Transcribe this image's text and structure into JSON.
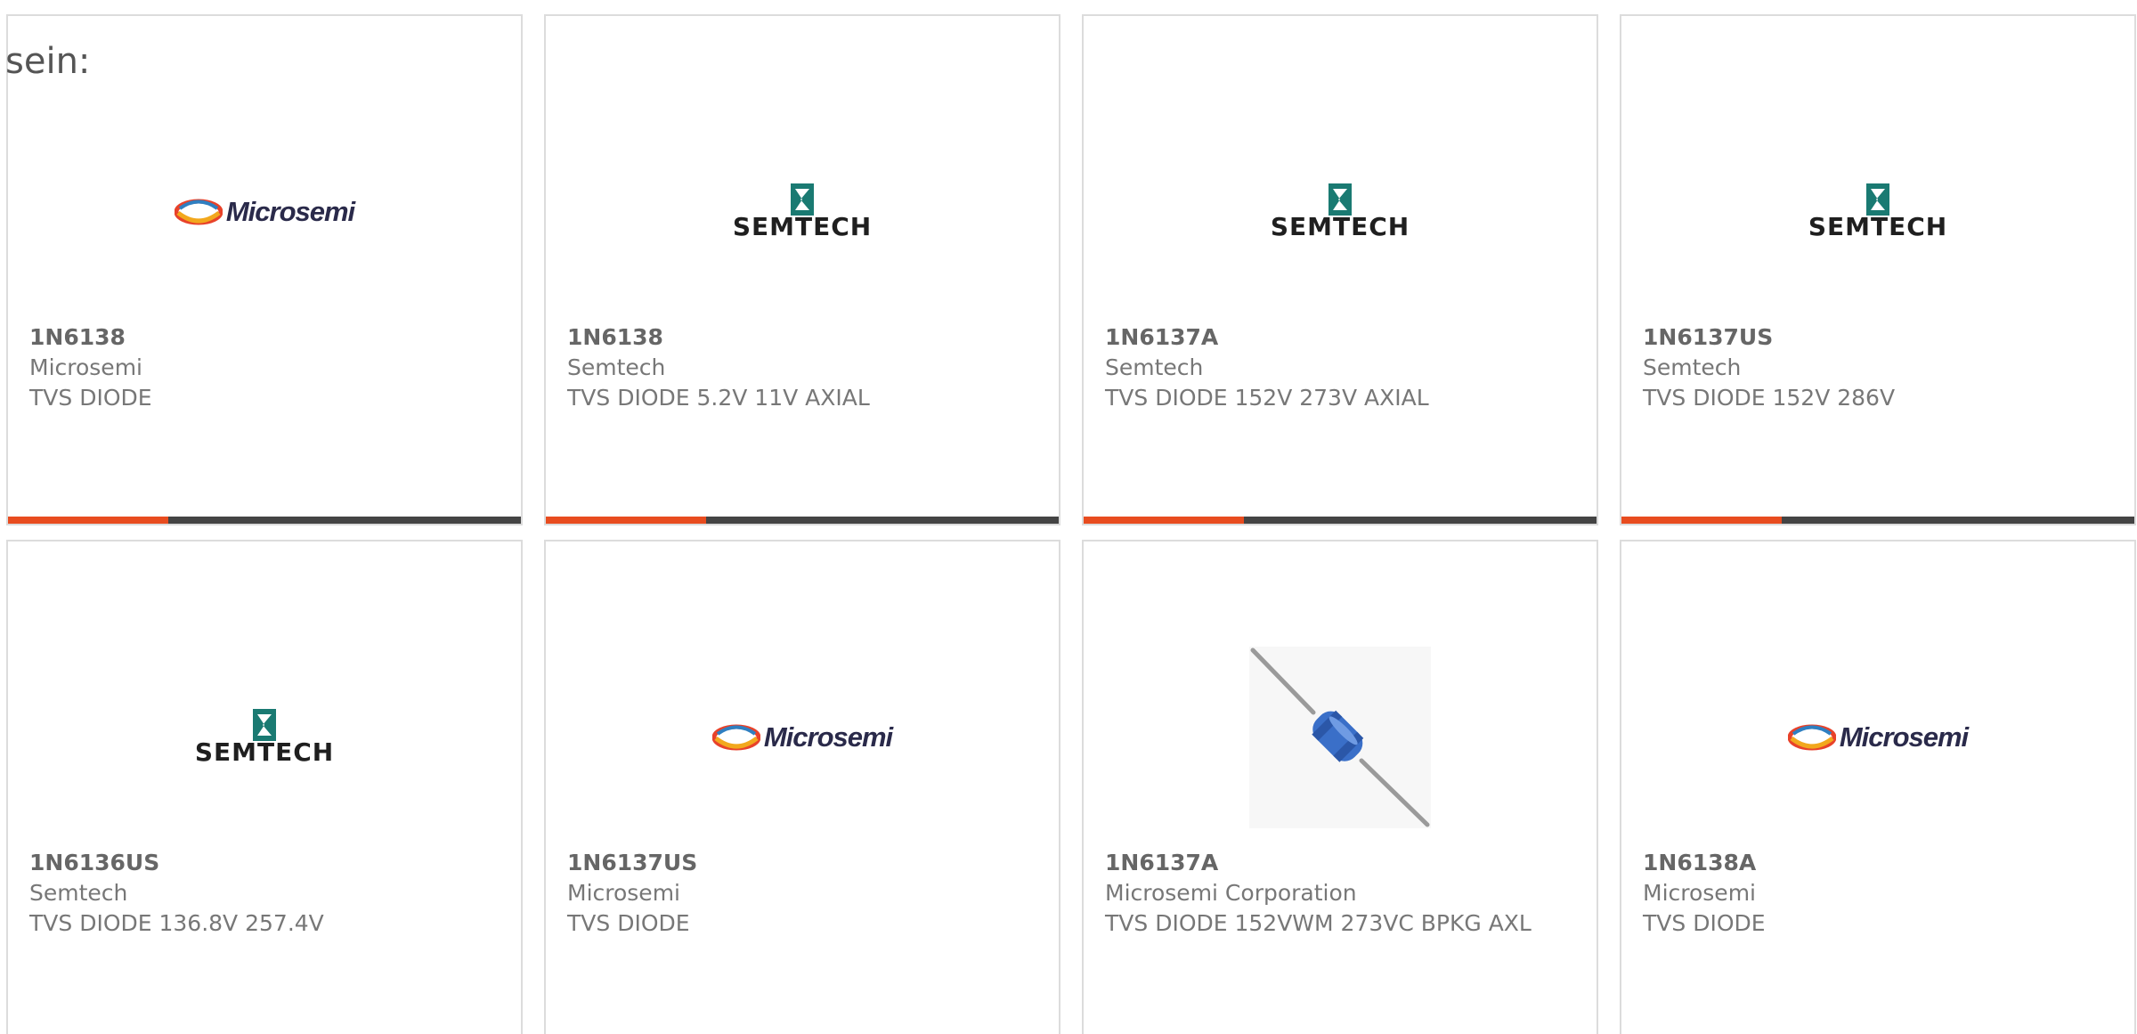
{
  "intro_text": "sein:",
  "colors": {
    "accent": "#e84c1f",
    "bar_dark": "#444444",
    "border": "#dcdcdc",
    "microsemi_text": "#2a2a4a",
    "semtech_teal": "#1a7a72"
  },
  "products": [
    {
      "part": "1N6138",
      "manufacturer": "Microsemi",
      "description": "TVS DIODE",
      "logo": "microsemi-logo",
      "logo_text": "Microsemi"
    },
    {
      "part": "1N6138",
      "manufacturer": "Semtech",
      "description": "TVS DIODE 5.2V 11V AXIAL",
      "logo": "semtech-logo",
      "logo_text": "SEMTECH"
    },
    {
      "part": "1N6137A",
      "manufacturer": "Semtech",
      "description": "TVS DIODE 152V 273V AXIAL",
      "logo": "semtech-logo",
      "logo_text": "SEMTECH"
    },
    {
      "part": "1N6137US",
      "manufacturer": "Semtech",
      "description": "TVS DIODE 152V 286V",
      "logo": "semtech-logo",
      "logo_text": "SEMTECH"
    },
    {
      "part": "1N6136US",
      "manufacturer": "Semtech",
      "description": "TVS DIODE 136.8V 257.4V",
      "logo": "semtech-logo",
      "logo_text": "SEMTECH"
    },
    {
      "part": "1N6137US",
      "manufacturer": "Microsemi",
      "description": "TVS DIODE",
      "logo": "microsemi-logo",
      "logo_text": "Microsemi"
    },
    {
      "part": "1N6137A",
      "manufacturer": "Microsemi Corporation",
      "description": "TVS DIODE 152VWM 273VC BPKG AXL",
      "logo": "axial-diode-photo"
    },
    {
      "part": "1N6138A",
      "manufacturer": "Microsemi",
      "description": "TVS DIODE",
      "logo": "microsemi-logo",
      "logo_text": "Microsemi"
    }
  ]
}
